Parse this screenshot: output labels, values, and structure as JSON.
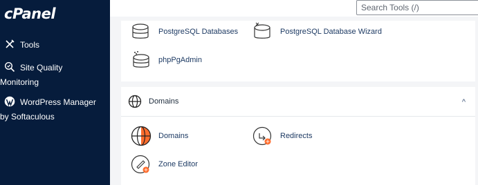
{
  "sidebar": {
    "logo": "cPanel",
    "items": [
      {
        "label": "Tools"
      },
      {
        "label_line1": "Site Quality",
        "label_line2": "Monitoring"
      },
      {
        "label_line1": "WordPress Manager",
        "label_line2": "by Softaculous"
      }
    ]
  },
  "search": {
    "placeholder": "Search Tools (/)"
  },
  "databases": {
    "tools": [
      {
        "label": "PostgreSQL Databases"
      },
      {
        "label": "PostgreSQL Database Wizard"
      },
      {
        "label": "phpPgAdmin"
      }
    ]
  },
  "domains": {
    "title": "Domains",
    "chevron": "^",
    "tools": [
      {
        "label": "Domains"
      },
      {
        "label": "Redirects"
      },
      {
        "label": "Zone Editor"
      }
    ]
  },
  "colors": {
    "sidebar": "#061c3c",
    "accent": "#ff6c2c",
    "link": "#1d3a63"
  }
}
